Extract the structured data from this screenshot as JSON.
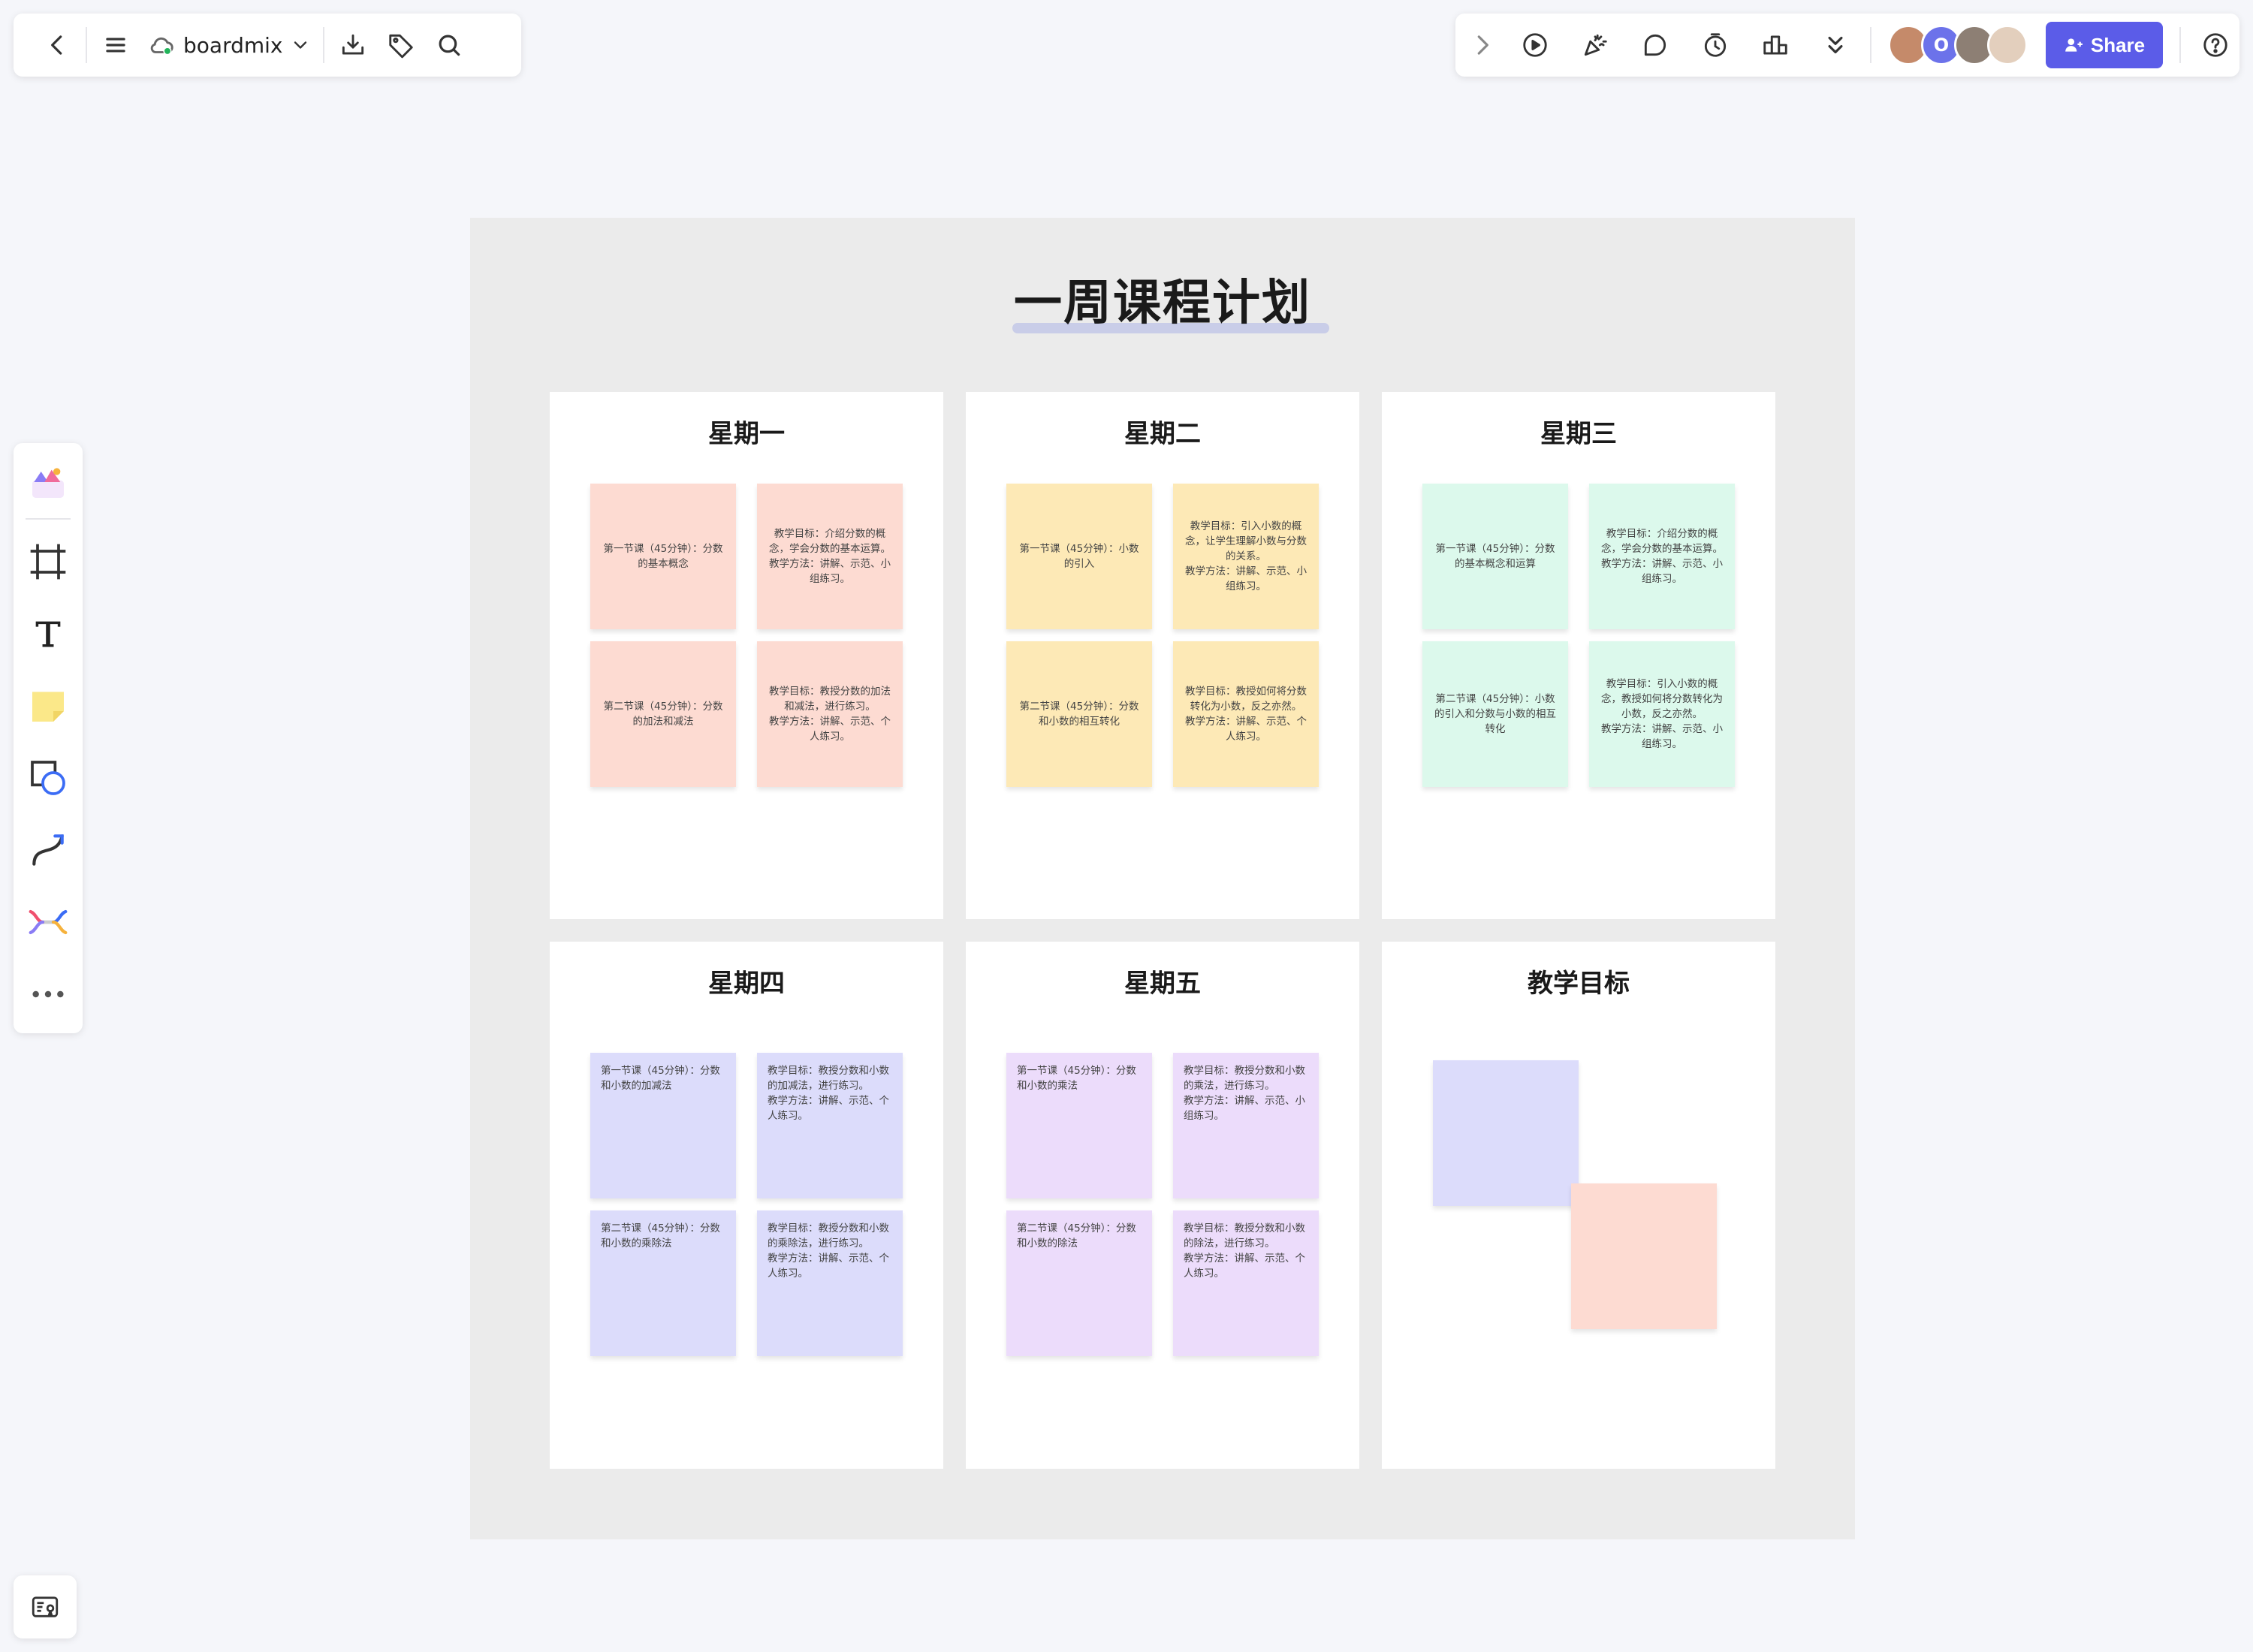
{
  "toolbar": {
    "doc_name": "boardmix",
    "share_label": "Share",
    "avatar_letter": "O"
  },
  "colors": {
    "accent": "#5b5ce8",
    "note_pink": "#fddbd2",
    "note_yellow": "#fde9b6",
    "note_green": "#dcf9ec",
    "note_lavender": "#dcdcfb",
    "note_purple": "#ecdcfb"
  },
  "board": {
    "title": "一周课程计划",
    "days": [
      {
        "title": "星期一",
        "notes": [
          {
            "lines": [
              "第一节课（45分钟）：分数的基本概念"
            ]
          },
          {
            "lines": [
              "教学目标：介绍分数的概念，学会分数的基本运算。",
              "教学方法：讲解、示范、小组练习。"
            ]
          },
          {
            "lines": [
              "第二节课（45分钟）：分数的加法和减法"
            ]
          },
          {
            "lines": [
              "教学目标：教授分数的加法和减法，进行练习。",
              "教学方法：讲解、示范、个人练习。"
            ]
          }
        ]
      },
      {
        "title": "星期二",
        "notes": [
          {
            "lines": [
              "第一节课（45分钟）：小数的引入"
            ]
          },
          {
            "lines": [
              "教学目标：引入小数的概念，让学生理解小数与分数的关系。",
              "教学方法：讲解、示范、小组练习。"
            ]
          },
          {
            "lines": [
              "第二节课（45分钟）：分数和小数的相互转化"
            ]
          },
          {
            "lines": [
              "教学目标：教授如何将分数转化为小数，反之亦然。",
              "教学方法：讲解、示范、个人练习。"
            ]
          }
        ]
      },
      {
        "title": "星期三",
        "notes": [
          {
            "lines": [
              "第一节课（45分钟）：分数的基本概念和运算"
            ]
          },
          {
            "lines": [
              "教学目标：介绍分数的概念，学会分数的基本运算。",
              "教学方法：讲解、示范、小组练习。"
            ]
          },
          {
            "lines": [
              "第二节课（45分钟）：小数的引入和分数与小数的相互转化"
            ]
          },
          {
            "lines": [
              "教学目标：引入小数的概念，教授如何将分数转化为小数，反之亦然。",
              "教学方法：讲解、示范、小组练习。"
            ]
          }
        ]
      },
      {
        "title": "星期四",
        "notes": [
          {
            "lines": [
              "第一节课（45分钟）：分数和小数的加减法"
            ]
          },
          {
            "lines": [
              "教学目标：教授分数和小数的加减法，进行练习。",
              "教学方法：讲解、示范、个人练习。"
            ]
          },
          {
            "lines": [
              "第二节课（45分钟）：分数和小数的乘除法"
            ]
          },
          {
            "lines": [
              "教学目标：教授分数和小数的乘除法，进行练习。",
              "教学方法：讲解、示范、个人练习。"
            ]
          }
        ]
      },
      {
        "title": "星期五",
        "notes": [
          {
            "lines": [
              "第一节课（45分钟）：分数和小数的乘法"
            ]
          },
          {
            "lines": [
              "教学目标：教授分数和小数的乘法，进行练习。",
              "教学方法：讲解、示范、小组练习。"
            ]
          },
          {
            "lines": [
              "第二节课（45分钟）：分数和小数的除法"
            ]
          },
          {
            "lines": [
              "教学目标：教授分数和小数的除法，进行练习。",
              "教学方法：讲解、示范、个人练习。"
            ]
          }
        ]
      }
    ],
    "goals": {
      "title": "教学目标"
    }
  }
}
